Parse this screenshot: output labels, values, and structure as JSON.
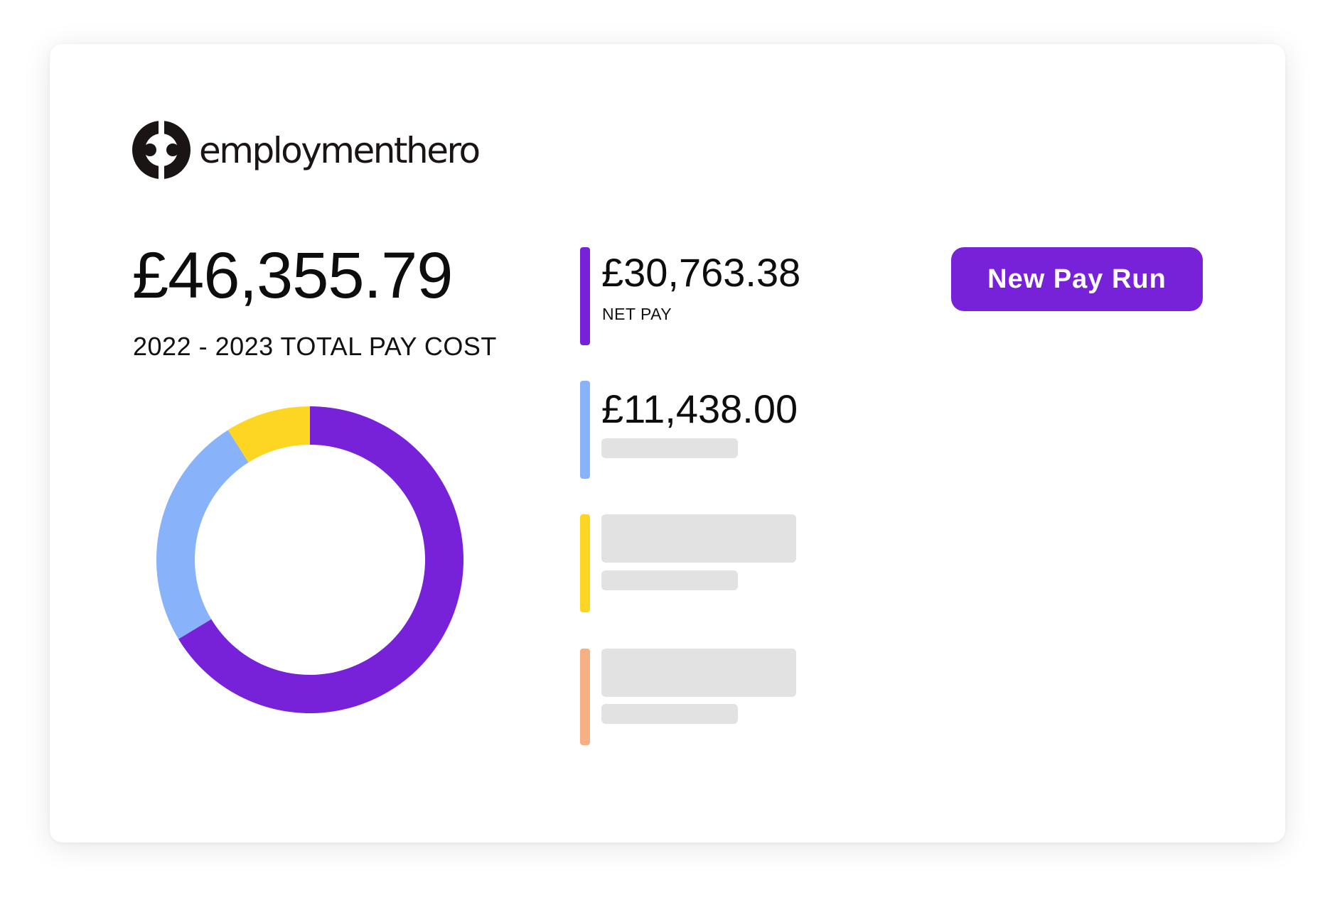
{
  "brand": {
    "name": "employmenthero",
    "logo_icon": "employment-hero-logo-icon"
  },
  "summary": {
    "total_amount": "£46,355.79",
    "total_label": "2022 - 2023 TOTAL PAY COST"
  },
  "breakdown": [
    {
      "amount": "£30,763.38",
      "label": "NET PAY",
      "color": "#7722D9"
    },
    {
      "amount": "£11,438.00",
      "label": "",
      "color": "#88B2FA"
    },
    {
      "amount": "",
      "label": "",
      "color": "#FDD623"
    },
    {
      "amount": "",
      "label": "",
      "color": "#F6B083"
    }
  ],
  "actions": {
    "new_pay_run_label": "New Pay Run"
  },
  "colors": {
    "accent": "#7722D9",
    "placeholder": "#E2E2E2"
  },
  "chart_data": {
    "type": "pie",
    "variant": "donut",
    "values": [
      30763.38,
      11438.0,
      4154.41
    ],
    "colors": [
      "#7722D9",
      "#88B2FA",
      "#FDD623"
    ]
  }
}
